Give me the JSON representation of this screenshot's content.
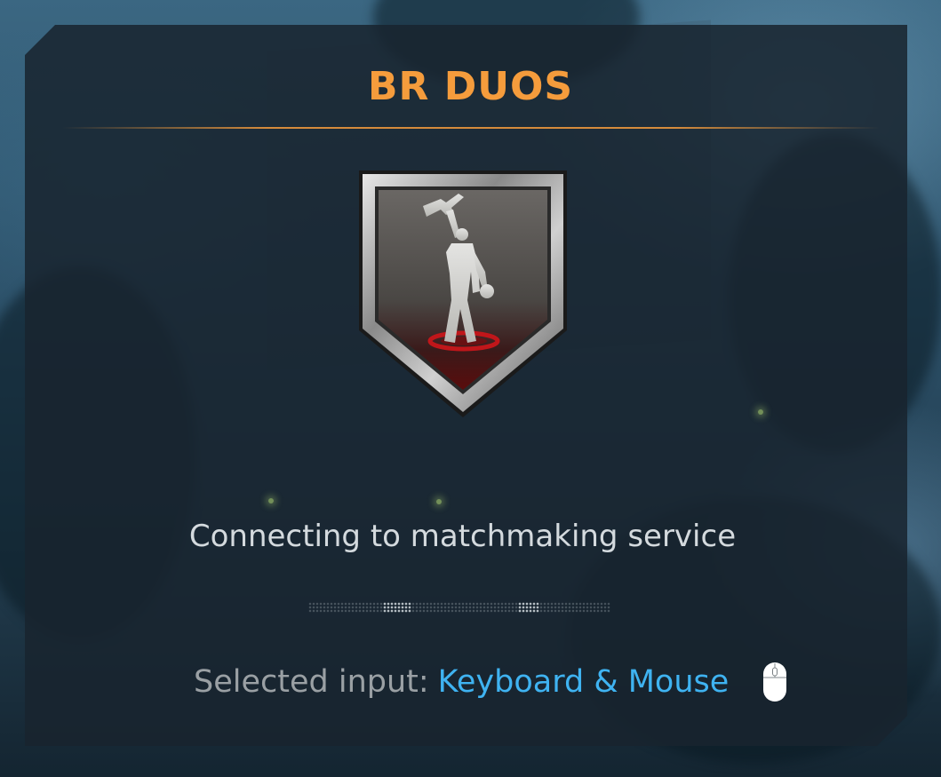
{
  "screen": {
    "mode_title": "BR DUOS",
    "status_text": "Connecting to matchmaking service",
    "progress": {
      "state": "indeterminate",
      "highlight_segments": 2
    }
  },
  "input": {
    "label": "Selected input:",
    "value": "Keyboard & Mouse",
    "icon": "mouse-icon"
  },
  "badge": {
    "icon": "soldier-emblem-icon"
  },
  "colors": {
    "title_accent": "#f59c3c",
    "input_value": "#3fb3f1",
    "status_text": "#d4dade",
    "label_text": "#9aa0a4",
    "panel_bg": "#18242e"
  }
}
